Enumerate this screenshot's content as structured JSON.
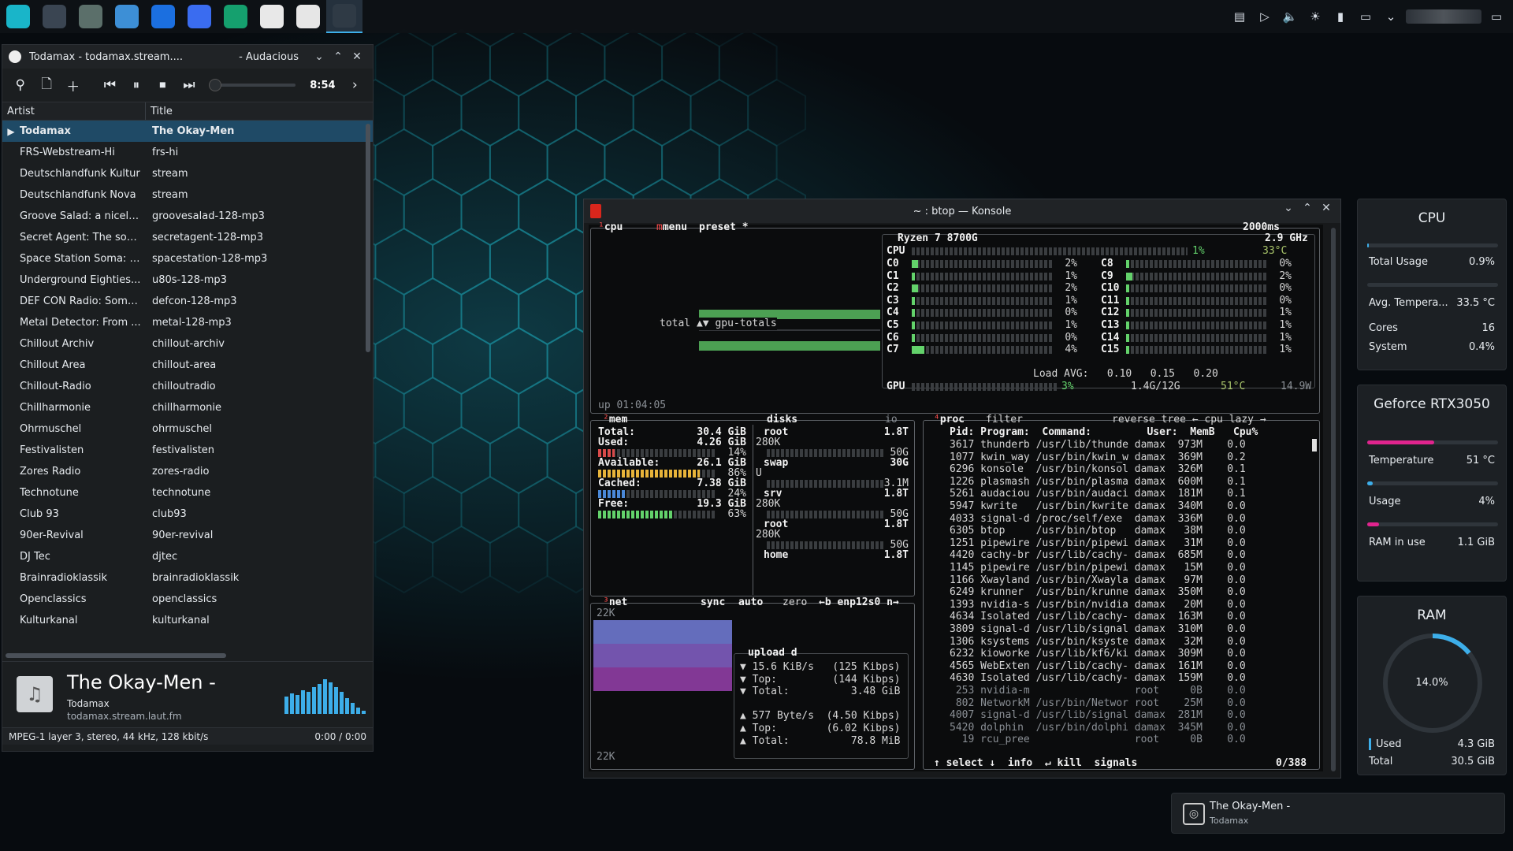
{
  "taskbar": {
    "apps": [
      {
        "icon": "app-launcher-icon",
        "color": "#19b5c9"
      },
      {
        "icon": "settings-sliders-icon",
        "color": "#3a4552"
      },
      {
        "icon": "screenshot-icon",
        "color": "#5b6f6a"
      },
      {
        "icon": "file-manager-icon",
        "color": "#3d8fd6"
      },
      {
        "icon": "browser-icon",
        "color": "#1b6fe0"
      },
      {
        "icon": "signal-icon",
        "color": "#3a6cf0"
      },
      {
        "icon": "hexagon-app-icon",
        "color": "#15a06e"
      },
      {
        "icon": "audacious-icon",
        "color": "#e8e8e8"
      },
      {
        "icon": "text-editor-icon",
        "color": "#e6e6e6"
      },
      {
        "icon": "konsole-icon",
        "color": "#2f3a45"
      }
    ],
    "tray": [
      "clipboard-icon",
      "media-player-icon",
      "volume-icon",
      "brightness-icon",
      "battery-icon",
      "display-icon",
      "chevron-up-icon"
    ]
  },
  "audacious": {
    "window_title": "Todamax - todamax.stream....",
    "window_app": "- Audacious",
    "time": "8:54",
    "columns": [
      "Artist",
      "Title"
    ],
    "rows": [
      {
        "artist": "Todamax",
        "title": "The Okay-Men",
        "playing": "▶"
      },
      {
        "artist": "FRS-Webstream-Hi",
        "title": "frs-hi"
      },
      {
        "artist": "Deutschlandfunk Kultur",
        "title": "stream"
      },
      {
        "artist": "Deutschlandfunk Nova",
        "title": "stream"
      },
      {
        "artist": "Groove Salad: a nicely ...",
        "title": "groovesalad-128-mp3"
      },
      {
        "artist": "Secret Agent: The sou...",
        "title": "secretagent-128-mp3"
      },
      {
        "artist": "Space Station Soma: T...",
        "title": "spacestation-128-mp3"
      },
      {
        "artist": "Underground Eighties...",
        "title": "u80s-128-mp3"
      },
      {
        "artist": "DEF CON Radio: Soma...",
        "title": "defcon-128-mp3"
      },
      {
        "artist": "Metal Detector: From ...",
        "title": "metal-128-mp3"
      },
      {
        "artist": "Chillout Archiv",
        "title": "chillout-archiv"
      },
      {
        "artist": "Chillout Area",
        "title": "chillout-area"
      },
      {
        "artist": "Chillout-Radio",
        "title": "chilloutradio"
      },
      {
        "artist": "Chillharmonie",
        "title": "chillharmonie"
      },
      {
        "artist": "Ohrmuschel",
        "title": "ohrmuschel"
      },
      {
        "artist": "Festivalisten",
        "title": "festivalisten"
      },
      {
        "artist": "Zores Radio",
        "title": "zores-radio"
      },
      {
        "artist": "Technotune",
        "title": "technotune"
      },
      {
        "artist": "Club 93",
        "title": "club93"
      },
      {
        "artist": "90er-Revival",
        "title": "90er-revival"
      },
      {
        "artist": "DJ Tec",
        "title": "djtec"
      },
      {
        "artist": "Brainradioklassik",
        "title": "brainradioklassik"
      },
      {
        "artist": "Openclassics",
        "title": "openclassics"
      },
      {
        "artist": "Kulturkanal",
        "title": "kulturkanal"
      }
    ],
    "now_playing": {
      "title": "The Okay-Men -",
      "artist": "Todamax",
      "album": "todamax.stream.laut.fm"
    },
    "status_left": "MPEG-1 layer 3, stereo, 44 kHz, 128 kbit/s",
    "status_right": "0:00 / 0:00"
  },
  "konsole": {
    "title": "~ : btop — Konsole",
    "cpu": {
      "header": "cpu",
      "menu": "menu",
      "preset": "preset *",
      "interval": "2000ms",
      "model": "Ryzen 7 8700G",
      "freq": "2.9 GHz",
      "total_label": "CPU",
      "total_pct": "1%",
      "temp": "33°C",
      "cores_left": [
        {
          "name": "C0",
          "pct": "2%"
        },
        {
          "name": "C1",
          "pct": "1%"
        },
        {
          "name": "C2",
          "pct": "2%"
        },
        {
          "name": "C3",
          "pct": "1%"
        },
        {
          "name": "C4",
          "pct": "0%"
        },
        {
          "name": "C5",
          "pct": "1%"
        },
        {
          "name": "C6",
          "pct": "0%"
        },
        {
          "name": "C7",
          "pct": "4%"
        }
      ],
      "cores_right": [
        {
          "name": "C8",
          "pct": "0%"
        },
        {
          "name": "C9",
          "pct": "2%"
        },
        {
          "name": "C10",
          "pct": "0%"
        },
        {
          "name": "C11",
          "pct": "0%"
        },
        {
          "name": "C12",
          "pct": "1%"
        },
        {
          "name": "C13",
          "pct": "1%"
        },
        {
          "name": "C14",
          "pct": "1%"
        },
        {
          "name": "C15",
          "pct": "1%"
        }
      ],
      "load_avg": "Load AVG:   0.10   0.15   0.20",
      "gpu_line": "3%",
      "gpu_mem": "1.4G/12G",
      "gpu_temp": "51°C",
      "gpu_watt": "14.9W",
      "graph_label": "total ▲▼ gpu-totals",
      "uptime": "up 01:04:05"
    },
    "mem": {
      "header": "mem",
      "lines": [
        {
          "label": "Total:",
          "value": "30.4 GiB"
        },
        {
          "label": "Used:",
          "value": "4.26 GiB",
          "pct": "14%"
        },
        {
          "label": "Available:",
          "value": "26.1 GiB",
          "pct": "86%"
        },
        {
          "label": "Cached:",
          "value": "7.38 GiB",
          "pct": "24%"
        },
        {
          "label": "Free:",
          "value": "19.3 GiB",
          "pct": "63%"
        }
      ],
      "bar_levels": [
        0.14,
        0.86,
        0.24,
        0.63
      ]
    },
    "disks": {
      "header": "disks",
      "io": "io",
      "items": [
        {
          "name": "root",
          "size": "1.8T",
          "used": "280K",
          "free": "50G"
        },
        {
          "name": "swap",
          "size": "30G",
          "used": "U",
          "free": "3.1M"
        },
        {
          "name": "srv",
          "size": "1.8T",
          "used": "280K",
          "free": "50G"
        },
        {
          "name": "root",
          "size": "1.8T",
          "used": "280K",
          "free": "50G"
        },
        {
          "name": "home",
          "size": "1.8T",
          "used": "",
          "free": ""
        }
      ]
    },
    "net": {
      "header": "net",
      "sync": "sync",
      "auto": "auto",
      "zero": "zero",
      "iface": "←b enp12s0 n→",
      "scale_top": "22K",
      "scale_bottom": "22K",
      "upload_title": "upload d",
      "lines": [
        "▼ 15.6 KiB/s   (125 Kibps)",
        "▼ Top:         (144 Kibps)",
        "▼ Total:          3.48 GiB",
        "",
        "▲ 577 Byte/s  (4.50 Kibps)",
        "▲ Top:        (6.02 Kibps)",
        "▲ Total:          78.8 MiB"
      ]
    },
    "proc": {
      "header": "proc",
      "filter": "filter",
      "options": "reverse tree ← cpu lazy →",
      "columns": "Pid: Program:  Command:         User:  MemB   Cpu%",
      "rows": [
        "3617 thunderb /usr/lib/thunde damax  973M    0.0",
        "1077 kwin_way /usr/bin/kwin_w damax  369M    0.2",
        "6296 konsole  /usr/bin/konsol damax  326M    0.1",
        "1226 plasmash /usr/bin/plasma damax  600M    0.1",
        "5261 audaciou /usr/bin/audaci damax  181M    0.1",
        "5947 kwrite   /usr/bin/kwrite damax  340M    0.0",
        "4033 signal-d /proc/self/exe  damax  336M    0.0",
        "6305 btop     /usr/bin/btop   damax   38M    0.0",
        "1251 pipewire /usr/bin/pipewi damax   31M    0.0",
        "4420 cachy-br /usr/lib/cachy- damax  685M    0.0",
        "1145 pipewire /usr/bin/pipewi damax   15M    0.0",
        "1166 Xwayland /usr/bin/Xwayla damax   97M    0.0",
        "6249 krunner  /usr/bin/krunne damax  350M    0.0",
        "1393 nvidia-s /usr/bin/nvidia damax   20M    0.0",
        "4634 Isolated /usr/lib/cachy- damax  163M    0.0",
        "3809 signal-d /usr/lib/signal damax  310M    0.0",
        "1306 ksystems /usr/bin/ksyste damax   32M    0.0",
        "6232 kioworke /usr/lib/kf6/ki damax  309M    0.0",
        "4565 WebExten /usr/lib/cachy- damax  161M    0.0",
        "4630 Isolated /usr/lib/cachy- damax  159M    0.0",
        " 253 nvidia-m                 root     0B    0.0",
        " 802 NetworkM /usr/bin/Networ root    25M    0.0",
        "4007 signal-d /usr/lib/signal damax  281M    0.0",
        "5420 dolphin  /usr/bin/dolphi damax  345M    0.0",
        "  19 rcu_pree                 root     0B    0.0"
      ],
      "footer": "↑ select ↓  info  ↵ kill  signals",
      "count": "0/388"
    }
  },
  "widgets": {
    "cpu": {
      "title": "CPU",
      "total_label": "Total Usage",
      "total_value": "0.9%",
      "total_level": 0.009,
      "temp_label": "Avg. Tempera...",
      "temp_value": "33.5 °C",
      "cores_label": "Cores",
      "cores_value": "16",
      "system_label": "System",
      "system_value": "0.4%"
    },
    "gpu": {
      "title": "Geforce RTX3050",
      "temp_label": "Temperature",
      "temp_value": "51 °C",
      "temp_level": 0.51,
      "usage_label": "Usage",
      "usage_value": "4%",
      "usage_level": 0.04,
      "ram_label": "RAM in use",
      "ram_value": "1.1 GiB",
      "ram_level": 0.09
    },
    "ram": {
      "title": "RAM",
      "percent": "14.0%",
      "level": 0.14,
      "used_label": "Used",
      "used_value": "4.3 GiB",
      "total_label": "Total",
      "total_value": "30.5 GiB"
    }
  },
  "notification": {
    "title": "The Okay-Men -",
    "subtitle": "Todamax"
  },
  "colors": {
    "accent": "#3daee9",
    "gpu_bar": "#e0248e",
    "btop_green": "#63d26b",
    "btop_red": "#ff4d4d"
  }
}
